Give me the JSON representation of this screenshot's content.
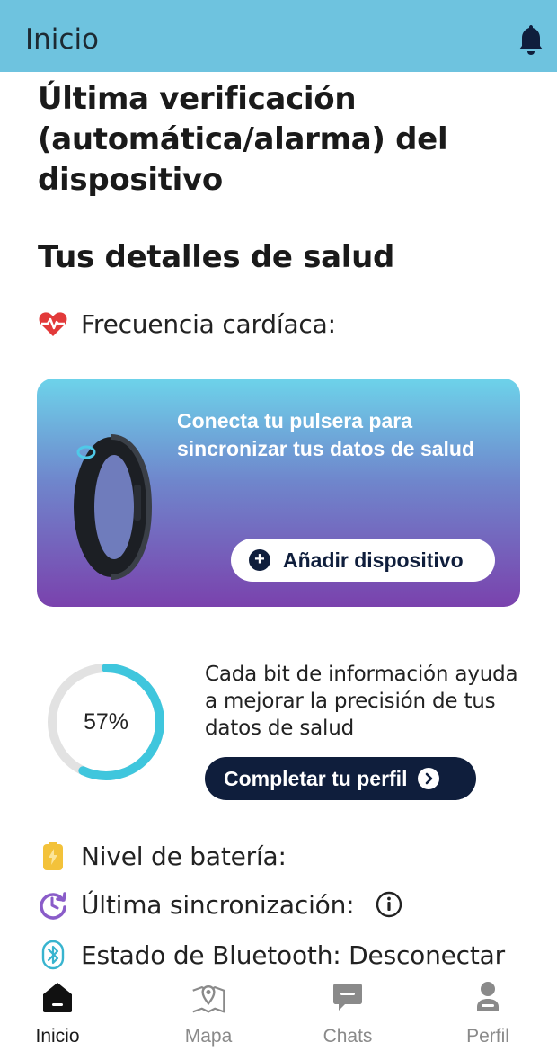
{
  "header": {
    "title": "Inicio",
    "bell_icon": "bell-icon"
  },
  "headline": "Última verificación (automática/alarma) del dispositivo",
  "health_section": {
    "title": "Tus detalles de salud",
    "heart_rate_label": "Frecuencia cardíaca:",
    "heart_icon": "heart-pulse-icon"
  },
  "banner": {
    "message": "Conecta tu pulsera para sincronizar tus datos de salud",
    "add_device_label": "Añadir dispositivo",
    "gradient_top": "#6dd3ea",
    "gradient_bottom": "#7a42ad"
  },
  "profile_progress": {
    "percent": 57,
    "percent_label": "57%",
    "info_text": "Cada bit de información ayuda a mejorar la precisión de tus datos de salud",
    "complete_button_label": "Completar tu perfil",
    "ring_color": "#3fc6dd",
    "track_color": "#e2e2e2"
  },
  "status_rows": {
    "battery_label": "Nivel de batería:",
    "last_sync_label": "Última sincronización:",
    "bluetooth_label": "Estado de Bluetooth: Desconectar"
  },
  "colors": {
    "header_bg": "#6ec3df",
    "primary_dark": "#0f1e3c",
    "heart_red": "#e23a3a",
    "battery_amber": "#f3c23a",
    "sync_purple": "#8a5cc9",
    "bluetooth_teal": "#38b4cf"
  },
  "bottom_nav": {
    "items": [
      {
        "label": "Inicio",
        "icon": "home-icon",
        "active": true
      },
      {
        "label": "Mapa",
        "icon": "map-pin-icon",
        "active": false
      },
      {
        "label": "Chats",
        "icon": "chat-bubble-icon",
        "active": false
      },
      {
        "label": "Perfil",
        "icon": "person-icon",
        "active": false
      }
    ]
  }
}
